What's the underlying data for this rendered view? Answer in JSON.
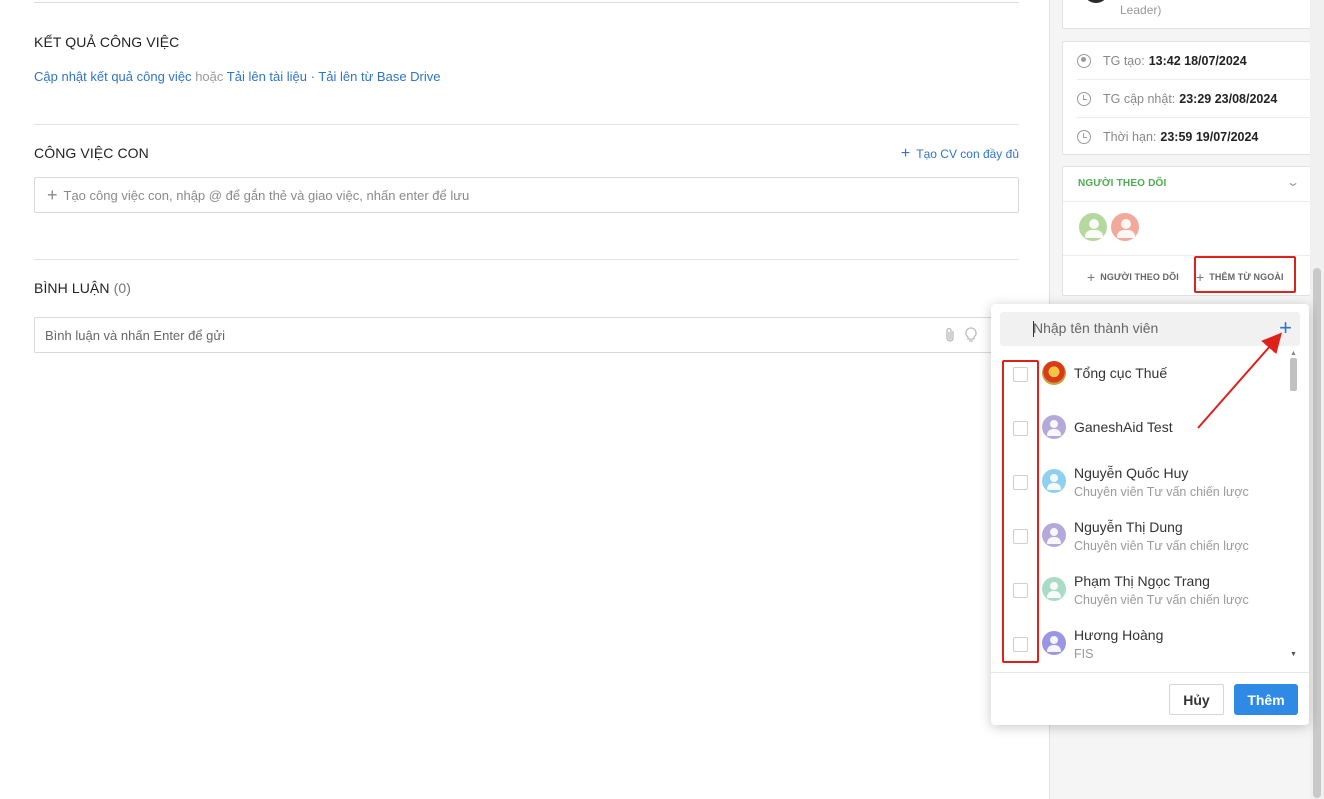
{
  "main": {
    "result": {
      "title": "KẾT QUẢ CÔNG VIỆC",
      "update_link": "Cập nhật kết quả công việc",
      "or_text": "hoặc",
      "upload_doc": "Tải lên tài liệu",
      "separator": "·",
      "upload_drive": "Tải lên từ Base Drive"
    },
    "subtasks": {
      "title": "CÔNG VIỆC CON",
      "full_link": "Tạo CV con đầy đủ",
      "input_placeholder": "Tạo công việc con, nhập @ để gắn thẻ và giao việc, nhấn enter để lưu"
    },
    "comments": {
      "title": "BÌNH LUẬN",
      "count": "(0)",
      "input_placeholder": "Bình luận và nhấn Enter để gửi"
    }
  },
  "sidebar": {
    "top_card_text": "Leader)",
    "times": [
      {
        "label": "TG tạo:",
        "value": "13:42 18/07/2024",
        "icon": "user-circle-icon"
      },
      {
        "label": "TG cập nhật:",
        "value": "23:29 23/08/2024",
        "icon": "clock-icon"
      },
      {
        "label": "Thời hạn:",
        "value": "23:59 19/07/2024",
        "icon": "clock-icon"
      }
    ],
    "followers": {
      "title": "NGƯỜI THEO DÕI",
      "avatar_colors": [
        "#b5d89e",
        "#f2a99b"
      ],
      "add_follower": "NGƯỜI THEO DÕI",
      "add_external": "THÊM TỪ NGOÀI"
    }
  },
  "popup": {
    "search_placeholder": "Nhập tên thành viên",
    "members": [
      {
        "name": "Tổng cục Thuế",
        "role": "",
        "avatar": "emblem",
        "color": "#d93a1b"
      },
      {
        "name": "GaneshAid Test",
        "role": "",
        "avatar": "person",
        "color": "#b4a9d8"
      },
      {
        "name": "Nguyễn Quốc Huy",
        "role": "Chuyên viên Tư vấn chiến lược",
        "avatar": "person",
        "color": "#8fd0f0"
      },
      {
        "name": "Nguyễn Thị Dung",
        "role": "Chuyên viên Tư vấn chiến lược",
        "avatar": "person",
        "color": "#b4a9d8"
      },
      {
        "name": "Phạm Thị Ngọc Trang",
        "role": "Chuyên viên Tư vấn chiến lược",
        "avatar": "person",
        "color": "#a9dcc6"
      },
      {
        "name": "Hương Hoàng",
        "role": "FIS",
        "avatar": "person",
        "color": "#9b95e3"
      }
    ],
    "cancel_label": "Hủy",
    "add_label": "Thêm"
  },
  "colors": {
    "link": "#2f75c9",
    "primary_button": "#2f8ae5",
    "highlight": "#e0201b",
    "followers_title": "#4caf50"
  }
}
